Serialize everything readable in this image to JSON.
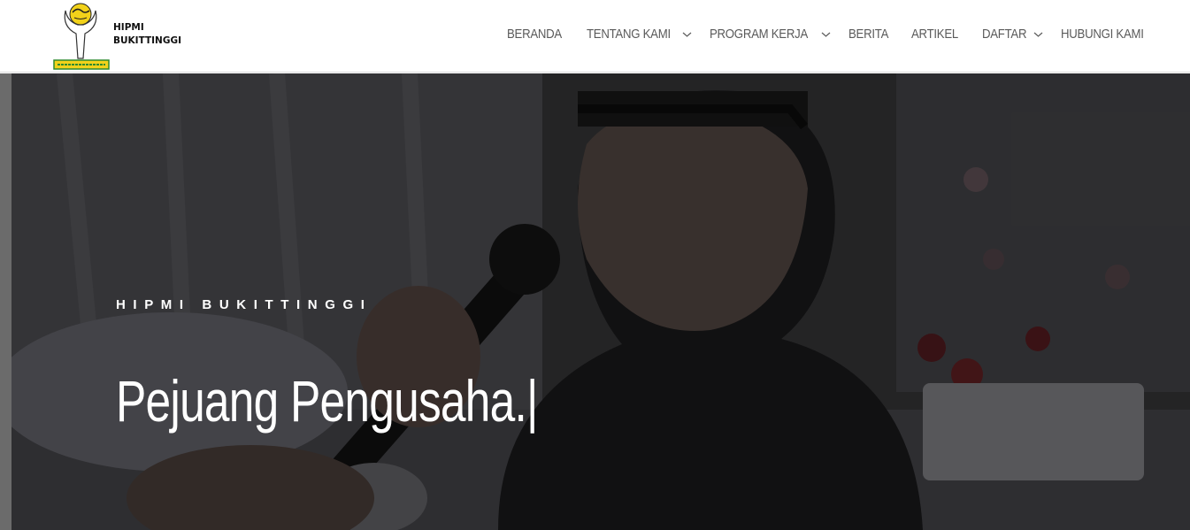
{
  "header": {
    "brand_line1": "HIPMI",
    "brand_line2": "BUKITTINGGI",
    "logo_icon": "hipmi-logo-icon"
  },
  "nav": {
    "items": [
      {
        "label": "BERANDA",
        "has_dropdown": false
      },
      {
        "label": "TENTANG KAMI",
        "has_dropdown": true
      },
      {
        "label": "PROGRAM KERJA",
        "has_dropdown": true
      },
      {
        "label": "BERITA",
        "has_dropdown": false
      },
      {
        "label": "ARTIKEL",
        "has_dropdown": false
      },
      {
        "label": "DAFTAR",
        "has_dropdown": true
      },
      {
        "label": "HUBUNGI KAMI",
        "has_dropdown": false
      }
    ],
    "dropdown_icon": "chevron-down-icon"
  },
  "hero": {
    "kicker": "HIPMI BUKITTINGGI",
    "headline": "Pejuang Pengusaha.",
    "cursor": "|"
  },
  "colors": {
    "nav_text": "#5a5a5a",
    "hero_overlay": "#1d1d1f",
    "logo_yellow": "#f2d21a",
    "logo_green": "#2f8a2f"
  }
}
